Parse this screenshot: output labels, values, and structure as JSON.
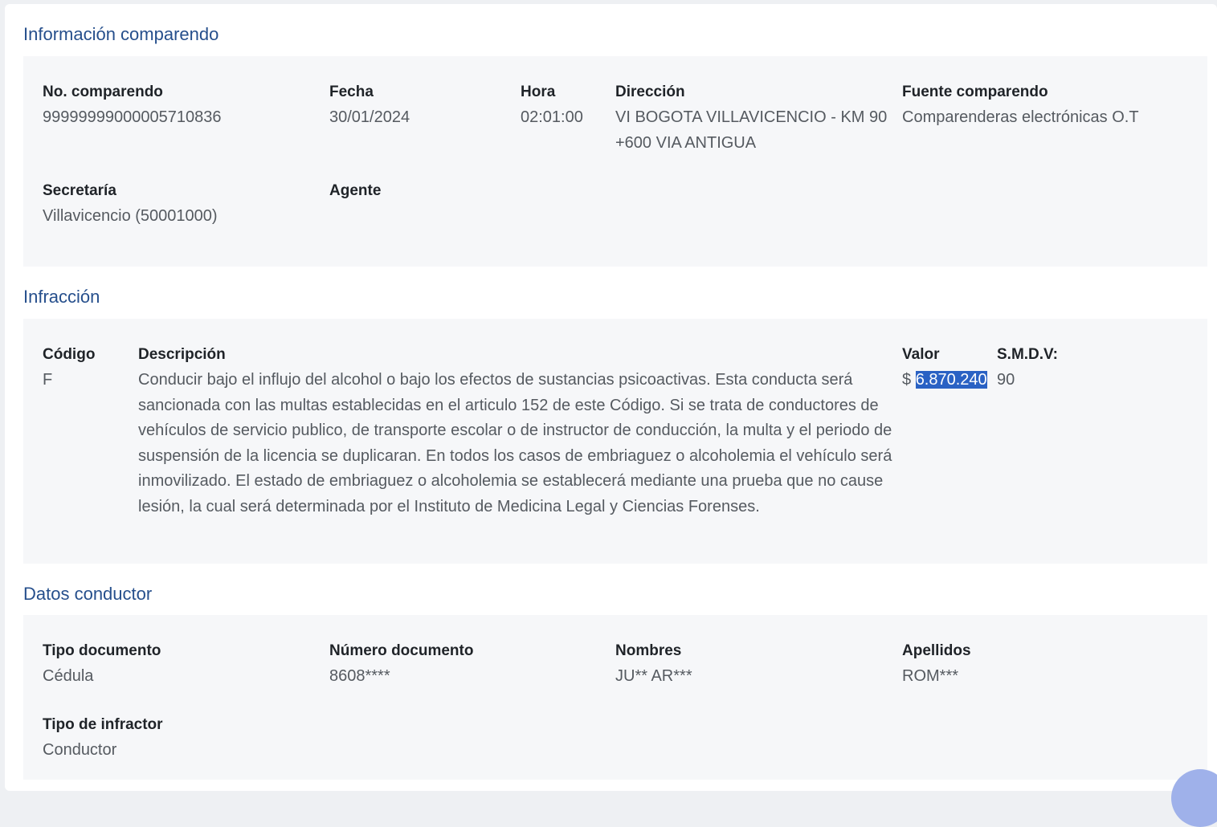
{
  "comparendo": {
    "title": "Información comparendo",
    "no_label": "No. comparendo",
    "no_value": "99999999000005710836",
    "fecha_label": "Fecha",
    "fecha_value": "30/01/2024",
    "hora_label": "Hora",
    "hora_value": "02:01:00",
    "direccion_label": "Dirección",
    "direccion_value": "VI BOGOTA VILLAVICENCIO - KM 90 +600 VIA ANTIGUA",
    "fuente_label": "Fuente comparendo",
    "fuente_value": "Comparenderas electrónicas O.T",
    "secretaria_label": "Secretaría",
    "secretaria_value": "Villavicencio (50001000)",
    "agente_label": "Agente",
    "agente_value": ""
  },
  "infraccion": {
    "title": "Infracción",
    "codigo_label": "Código",
    "codigo_value": "F",
    "descripcion_label": "Descripción",
    "descripcion_value": "Conducir bajo el influjo del alcohol o bajo los efectos de sustancias psicoactivas. Esta conducta será sancionada con las multas establecidas en el articulo 152 de este Código. Si se trata de conductores de vehículos de servicio publico, de transporte escolar o de instructor de conducción, la multa y el periodo de suspensión de la licencia se duplicaran. En todos los casos de embriaguez o alcoholemia el vehículo será inmovilizado. El estado de embriaguez o alcoholemia se establecerá mediante una prueba que no cause lesión, la cual será determinada por el Instituto de Medicina Legal y Ciencias Forenses.",
    "valor_label": "Valor",
    "valor_currency": "$",
    "valor_amount": "6.870.240",
    "smdv_label": "S.M.D.V:",
    "smdv_value": "90"
  },
  "conductor": {
    "title": "Datos conductor",
    "tipo_doc_label": "Tipo documento",
    "tipo_doc_value": "Cédula",
    "numero_doc_label": "Número documento",
    "numero_doc_value": "8608****",
    "nombres_label": "Nombres",
    "nombres_value": "JU** AR***",
    "apellidos_label": "Apellidos",
    "apellidos_value": "ROM***",
    "tipo_infractor_label": "Tipo de infractor",
    "tipo_infractor_value": "Conductor"
  },
  "colors": {
    "section_title": "#264f8c",
    "panel_bg": "#f6f7f9",
    "selection": "#2a62c4"
  }
}
